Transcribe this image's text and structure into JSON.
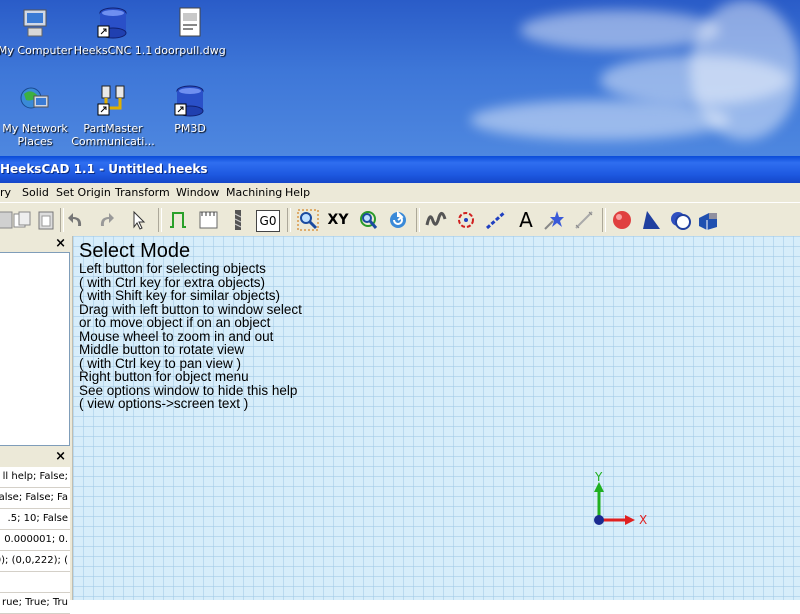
{
  "desktop": {
    "icons": [
      {
        "name": "My Computer",
        "icon": "computer-icon"
      },
      {
        "name": "HeeksCNC 1.1",
        "icon": "database-shortcut-icon"
      },
      {
        "name": "doorpull.dwg",
        "icon": "document-icon"
      },
      {
        "name": "My Network Places",
        "icon": "network-icon"
      },
      {
        "name": "PartMaster Communicati...",
        "icon": "partmaster-shortcut-icon"
      },
      {
        "name": "PM3D",
        "icon": "database-shortcut-icon"
      }
    ]
  },
  "window": {
    "title": "HeeksCAD 1.1 - Untitled.heeks"
  },
  "menu": [
    "ry",
    "Solid",
    "Set Origin",
    "Transform",
    "Window",
    "Machining",
    "Help"
  ],
  "toolbar": {
    "gcode_label": "G0",
    "text_tool_label": "A",
    "xy_view_label": "XY"
  },
  "panels": {
    "close_glyph": "×",
    "properties": [
      "ll help; False;",
      "False; False; Fa",
      ".5; 10; False",
      "; 0.000001; 0.",
      "0); (0,0,222); (",
      "",
      "rue; True; Tru",
      ""
    ]
  },
  "canvas": {
    "mode_title": "Select Mode",
    "help_lines": [
      "Left button for selecting objects",
      "( with Ctrl key for extra objects)",
      "( with Shift key for similar objects)",
      "Drag with left button to window select",
      "or to move object if on an object",
      "Mouse wheel to zoom in and out",
      "Middle button to rotate view",
      "( with Ctrl key to pan view )",
      "Right button for object menu",
      "See options window to hide this help",
      "( view options->screen text )"
    ],
    "axis_x_label": "X",
    "axis_y_label": "Y"
  },
  "colors": {
    "desktop_sky": "#3e77d8",
    "titlebar": "#1d58e0",
    "canvas_bg": "#d7edfa",
    "axis_x": "#e02020",
    "axis_y": "#20b020"
  }
}
